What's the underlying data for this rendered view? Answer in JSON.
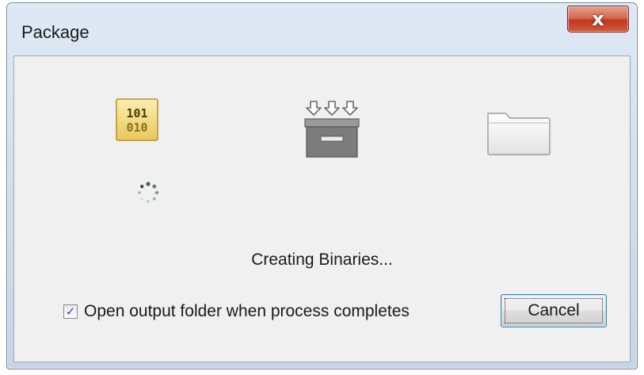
{
  "window": {
    "title": "Package",
    "close_label": "x"
  },
  "stages": [
    {
      "icon": "binary-file-icon",
      "glyph_top": "101",
      "glyph_bottom": "010"
    },
    {
      "icon": "archive-box-icon"
    },
    {
      "icon": "folder-icon"
    }
  ],
  "status": {
    "text": "Creating Binaries...",
    "active_stage": 1
  },
  "options": {
    "open_folder_label": "Open output folder when process completes",
    "open_folder_checked": true
  },
  "buttons": {
    "cancel_label": "Cancel"
  },
  "colors": {
    "binary_icon_bg": "#f5df8a",
    "binary_icon_text": "#5a4a10",
    "box_gray": "#7c7c7c",
    "checkbox_mark": "#1d4fb0",
    "close_red": "#c8452a"
  }
}
